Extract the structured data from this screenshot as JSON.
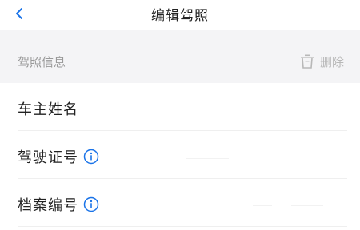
{
  "nav": {
    "title": "编辑驾照"
  },
  "section": {
    "title": "驾照信息",
    "delete_label": "删除"
  },
  "rows": [
    {
      "label": "车主姓名",
      "has_info_icon": false,
      "value": ""
    },
    {
      "label": "驾驶证号",
      "has_info_icon": true,
      "value": ""
    },
    {
      "label": "档案编号",
      "has_info_icon": true,
      "value": ""
    }
  ],
  "colors": {
    "accent": "#1a73e8",
    "section_bg": "#f4f4f6",
    "muted_text": "#999999"
  },
  "icons": {
    "back": "chevron-left-icon",
    "delete": "trash-icon",
    "info": "info-circle-icon"
  }
}
